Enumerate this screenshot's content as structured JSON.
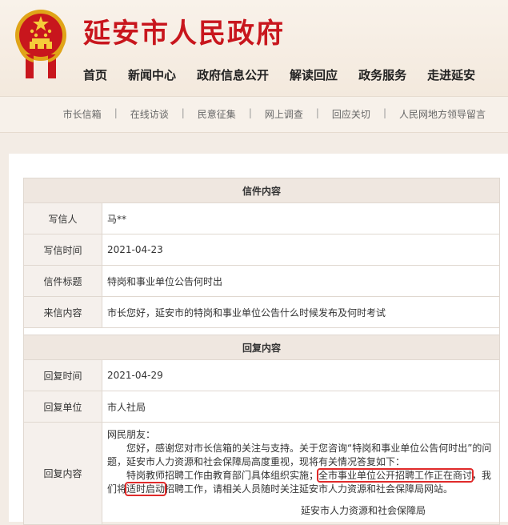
{
  "header": {
    "site_title": "延安市人民政府",
    "emblem_icon": "national-emblem-icon"
  },
  "nav": [
    "首页",
    "新闻中心",
    "政府信息公开",
    "解读回应",
    "政务服务",
    "走进延安"
  ],
  "subnav": [
    "市长信箱",
    "在线访谈",
    "民意征集",
    "网上调查",
    "回应关切",
    "人民网地方领导留言"
  ],
  "letter": {
    "section_title": "信件内容",
    "writer_label": "写信人",
    "writer_value": "马**",
    "date_label": "写信时间",
    "date_value": "2021-04-23",
    "subject_label": "信件标题",
    "subject_value": "特岗和事业单位公告何时出",
    "content_label": "来信内容",
    "content_value": "市长您好，延安市的特岗和事业单位公告什么时候发布及何时考试"
  },
  "reply": {
    "section_title": "回复内容",
    "time_label": "回复时间",
    "time_value": "2021-04-29",
    "unit_label": "回复单位",
    "unit_value": "市人社局",
    "content_label": "回复内容",
    "greeting": "网民朋友：",
    "para1": "您好，感谢您对市长信箱的关注与支持。关于您咨询“特岗和事业单位公告何时出”的问题，延安市人力资源和社会保障局高度重视，现将有关情况答复如下：",
    "para2_a": "特岗教师招聘工作由教育部门具体组织实施；",
    "para2_hl1": "全市事业单位公开招聘工作正在商讨",
    "para2_b": "，我们将",
    "para2_hl2": "适时启动",
    "para2_c": "招聘工作，请相关人员随时关注延安市人力资源和社会保障局网站。",
    "signature": "延安市人力资源和社会保障局"
  },
  "colors": {
    "title_red": "#c8161d",
    "highlight_red": "#e02a2a",
    "section_bg": "#efe7e0",
    "label_bg": "#f5f0ec"
  }
}
